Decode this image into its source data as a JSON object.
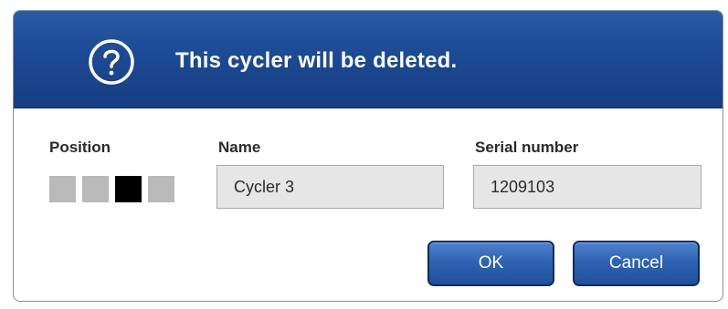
{
  "dialog": {
    "title": "This cycler will be deleted.",
    "icon": "question-circle-icon",
    "header_color": "#1c4a94"
  },
  "fields": {
    "position_label": "Position",
    "name_label": "Name",
    "name_value": "Cycler 3",
    "serial_label": "Serial number",
    "serial_value": "1209103"
  },
  "position_slots": [
    {
      "selected": false
    },
    {
      "selected": false
    },
    {
      "selected": true
    },
    {
      "selected": false
    }
  ],
  "buttons": {
    "ok_label": "OK",
    "cancel_label": "Cancel",
    "accent": "#2f63b3"
  }
}
